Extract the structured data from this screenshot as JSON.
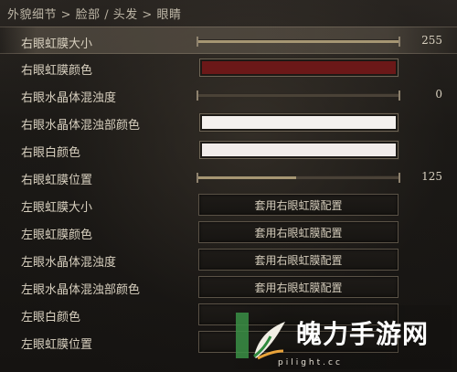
{
  "breadcrumb": "外貌细节 > 脸部 / 头发 > 眼睛",
  "rows": [
    {
      "label": "右眼虹膜大小",
      "kind": "slider",
      "value": "255",
      "level": 1.0
    },
    {
      "label": "右眼虹膜颜色",
      "kind": "color",
      "color": "#6b1818"
    },
    {
      "label": "右眼水晶体混浊度",
      "kind": "slider",
      "value": "0",
      "level": 0.0
    },
    {
      "label": "右眼水晶体混浊部颜色",
      "kind": "color",
      "color": "#f4f1ee"
    },
    {
      "label": "右眼白颜色",
      "kind": "color",
      "color": "#f1ecea"
    },
    {
      "label": "右眼虹膜位置",
      "kind": "slider",
      "value": "125",
      "level": 0.49
    },
    {
      "label": "左眼虹膜大小",
      "kind": "option",
      "option": "套用右眼虹膜配置"
    },
    {
      "label": "左眼虹膜颜色",
      "kind": "option",
      "option": "套用右眼虹膜配置"
    },
    {
      "label": "左眼水晶体混浊度",
      "kind": "option",
      "option": "套用右眼虹膜配置"
    },
    {
      "label": "左眼水晶体混浊部颜色",
      "kind": "option",
      "option": "套用右眼虹膜配置"
    },
    {
      "label": "左眼白颜色",
      "kind": "option",
      "option": ""
    },
    {
      "label": "左眼虹膜位置",
      "kind": "option",
      "option": ""
    }
  ],
  "watermark": {
    "text": "魄力手游网",
    "url": "pilight.cc",
    "logo_icon": "leaf-logo-icon",
    "accent": "#2f8a3e"
  },
  "selected_row": "右眼虹膜大小"
}
